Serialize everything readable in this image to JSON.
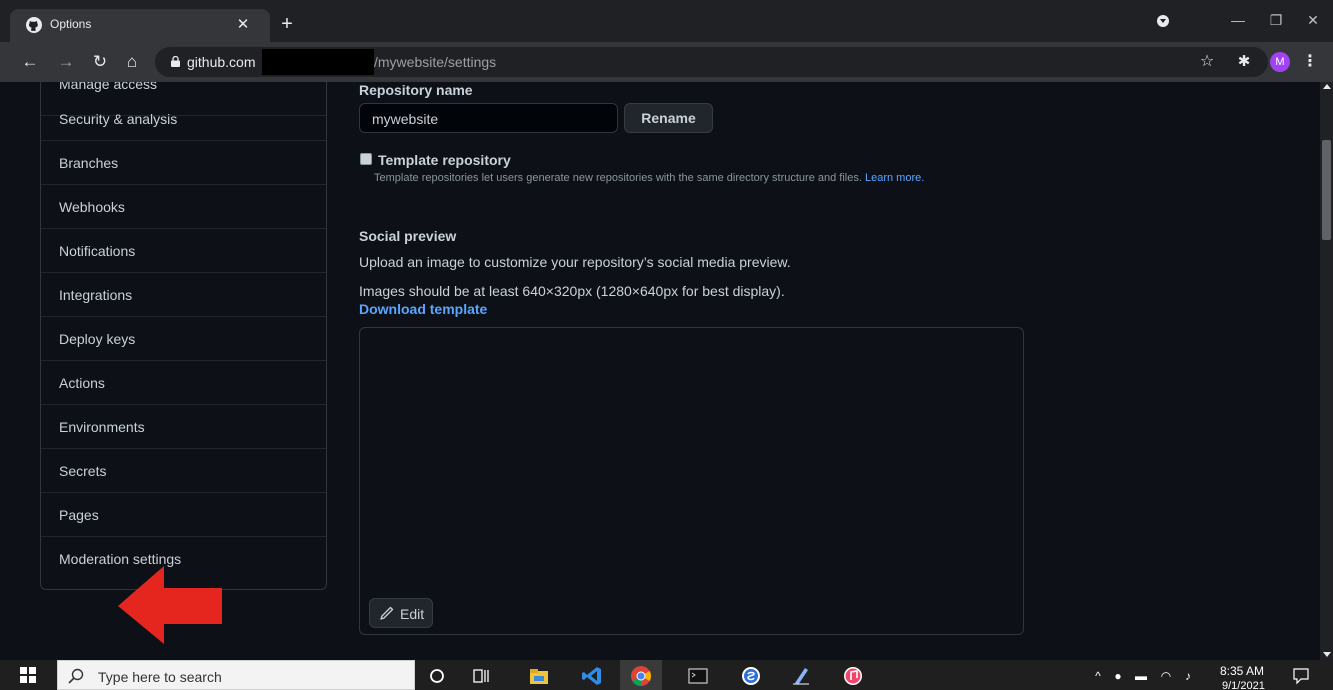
{
  "browser": {
    "tab_title": "Options",
    "url_host": "github.com",
    "url_path": "/mywebsite/settings"
  },
  "sidebar": {
    "items": [
      {
        "label": "Manage access"
      },
      {
        "label": "Security & analysis"
      },
      {
        "label": "Branches"
      },
      {
        "label": "Webhooks"
      },
      {
        "label": "Notifications"
      },
      {
        "label": "Integrations"
      },
      {
        "label": "Deploy keys"
      },
      {
        "label": "Actions"
      },
      {
        "label": "Environments"
      },
      {
        "label": "Secrets"
      },
      {
        "label": "Pages"
      },
      {
        "label": "Moderation settings"
      }
    ]
  },
  "settings": {
    "repo_name_label": "Repository name",
    "repo_name_value": "mywebsite",
    "rename_label": "Rename",
    "template_label": "Template repository",
    "template_checked": false,
    "template_help": "Template repositories let users generate new repositories with the same directory structure and files.",
    "template_help_link": "Learn more.",
    "social_preview_title": "Social preview",
    "social_preview_desc": "Upload an image to customize your repository’s social media preview.",
    "social_preview_size": "Images should be at least 640×320px (1280×640px for best display).",
    "download_template": "Download template",
    "edit_label": "Edit"
  },
  "taskbar": {
    "search_placeholder": "Type here to search",
    "time": "8:35 AM",
    "date": "9/1/2021"
  },
  "colors": {
    "page_bg": "#0d1117",
    "link": "#58a6ff",
    "annotation_arrow": "#e5261f"
  }
}
